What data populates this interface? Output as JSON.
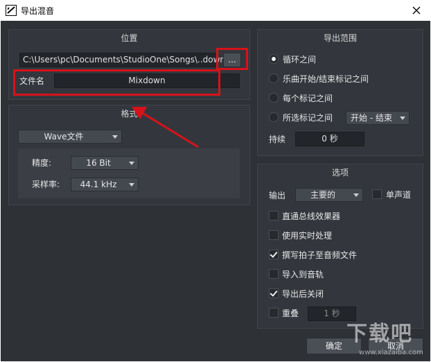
{
  "window": {
    "title": "导出混音",
    "app_icon": "studio-one-icon",
    "close_icon": "close-icon"
  },
  "location": {
    "header": "位置",
    "path_value": "C:\\Users\\pc\\Documents\\StudioOne\\Songs\\..down",
    "browse_label": "...",
    "filename_label": "文件名",
    "filename_value": "Mixdown"
  },
  "format": {
    "header": "格式",
    "file_type": "Wave文件",
    "precision_label": "精度:",
    "precision_value": "16 Bit",
    "samplerate_label": "采样率:",
    "samplerate_value": "44.1 kHz"
  },
  "range": {
    "header": "导出范围",
    "options": [
      {
        "label": "循环之间",
        "selected": true
      },
      {
        "label": "乐曲开始/结束标记之间",
        "selected": false
      },
      {
        "label": "每个标记之间",
        "selected": false
      },
      {
        "label": "所选标记之间",
        "selected": false
      }
    ],
    "marker_select": "开始 - 结束",
    "duration_label": "持续",
    "duration_value": "0 秒"
  },
  "options": {
    "header": "选项",
    "output_label": "输出",
    "output_value": "主要的",
    "mono_label": "单声道",
    "mono_checked": false,
    "checks": [
      {
        "label": "直通总线效果器",
        "checked": false
      },
      {
        "label": "使用实时处理",
        "checked": false
      },
      {
        "label": "撰写拍子至音频文件",
        "checked": true
      },
      {
        "label": "导入到音轨",
        "checked": false
      },
      {
        "label": "导出后关闭",
        "checked": true
      }
    ],
    "overlap_label": "重叠",
    "overlap_checked": false,
    "overlap_value": "1 秒"
  },
  "buttons": {
    "ok": "确定",
    "cancel": "取消"
  },
  "watermark": {
    "text": "下载吧",
    "sub": "www.xiazaiba.com"
  },
  "annotation_color": "#d8121a"
}
